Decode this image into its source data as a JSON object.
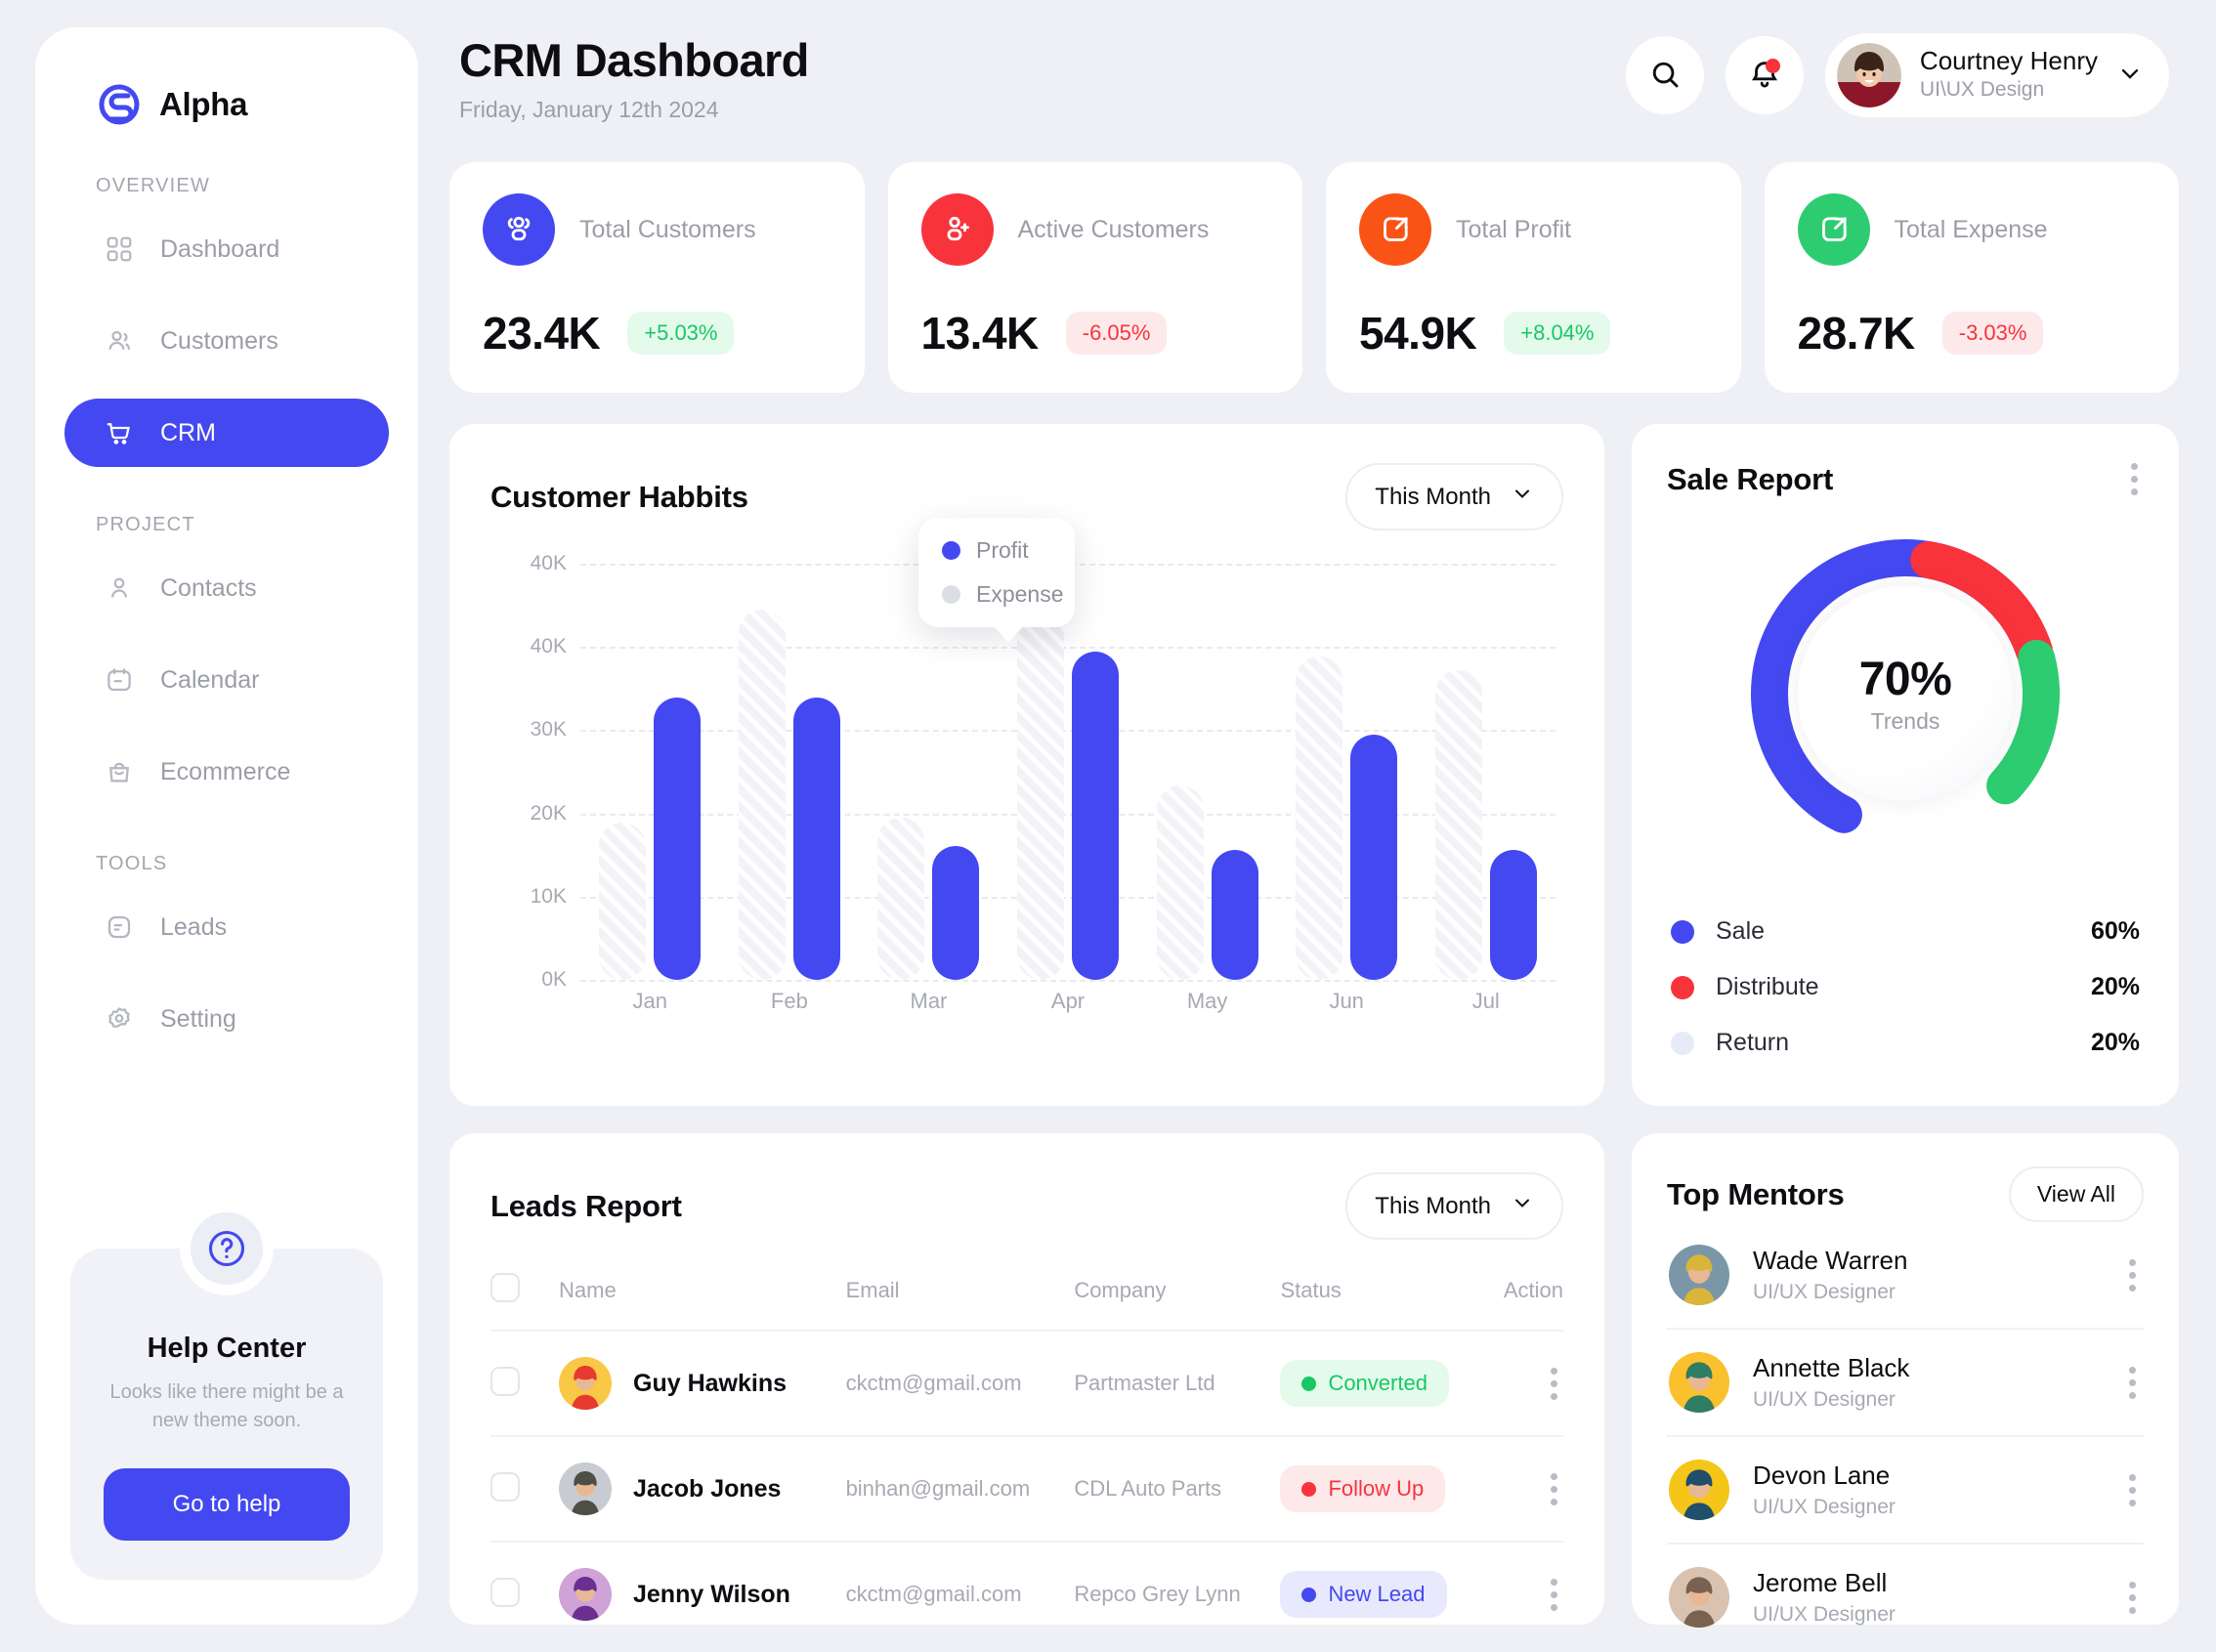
{
  "brand": {
    "name": "Alpha",
    "logo_icon": "alpha-s-logo"
  },
  "sidebar": {
    "sections": [
      {
        "label": "OVERVIEW",
        "items": [
          {
            "label": "Dashboard",
            "icon": "grid-icon",
            "active": false
          },
          {
            "label": "Customers",
            "icon": "users-icon",
            "active": false
          },
          {
            "label": "CRM",
            "icon": "cart-icon",
            "active": true
          }
        ]
      },
      {
        "label": "PROJECT",
        "items": [
          {
            "label": "Contacts",
            "icon": "user-icon",
            "active": false
          },
          {
            "label": "Calendar",
            "icon": "calendar-icon",
            "active": false
          },
          {
            "label": "Ecommerce",
            "icon": "bag-icon",
            "active": false
          }
        ]
      },
      {
        "label": "TOOLS",
        "items": [
          {
            "label": "Leads",
            "icon": "document-icon",
            "active": false
          },
          {
            "label": "Setting",
            "icon": "gear-icon",
            "active": false
          }
        ]
      }
    ],
    "help": {
      "icon": "question-mark-icon",
      "title": "Help Center",
      "subtitle": "Looks like there might be a new theme soon.",
      "button": "Go to help"
    }
  },
  "header": {
    "title": "CRM Dashboard",
    "date": "Friday, January 12th 2024",
    "search_icon": "search-icon",
    "bell_icon": "bell-icon",
    "user": {
      "name": "Courtney Henry",
      "role": "UI\\UX Design",
      "chevron": "chevron-down-icon"
    }
  },
  "stats": [
    {
      "label": "Total Customers",
      "value": "23.4K",
      "delta": "+5.03%",
      "dir": "up",
      "icon": "users-group-icon",
      "color": "#4448f0"
    },
    {
      "label": "Active Customers",
      "value": "13.4K",
      "delta": "-6.05%",
      "dir": "down",
      "icon": "user-plus-icon",
      "color": "#f8333c"
    },
    {
      "label": "Total Profit",
      "value": "54.9K",
      "delta": "+8.04%",
      "dir": "up",
      "icon": "arrow-in-box-icon",
      "color": "#fa5316"
    },
    {
      "label": "Total Expense",
      "value": "28.7K",
      "delta": "-3.03%",
      "dir": "down",
      "icon": "arrow-out-box-icon",
      "color": "#2ecc71"
    }
  ],
  "habits": {
    "title": "Customer Habbits",
    "filter": "This Month",
    "legend": [
      {
        "label": "Profit",
        "color": "#4448f0"
      },
      {
        "label": "Expense",
        "color": "#dcdee6"
      }
    ]
  },
  "chart_data": {
    "type": "bar",
    "title": "Customer Habbits",
    "xlabel": "",
    "ylabel": "",
    "categories": [
      "Jan",
      "Feb",
      "Mar",
      "Apr",
      "May",
      "Jun",
      "Jul"
    ],
    "ytick_labels": [
      "40K",
      "40K",
      "30K",
      "20K",
      "10K",
      "0K"
    ],
    "ylim": [
      0,
      45000
    ],
    "grid": true,
    "legend_position": "floating-top-center",
    "series": [
      {
        "name": "Expense",
        "color": "#dcdee6",
        "values": [
          17000,
          40000,
          17500,
          40000,
          21000,
          35000,
          33500
        ]
      },
      {
        "name": "Profit",
        "color": "#4448f0",
        "values": [
          30500,
          30500,
          14500,
          35500,
          14000,
          26500,
          14000
        ]
      }
    ]
  },
  "sale_report": {
    "title": "Sale Report",
    "kebab_icon": "more-vertical-icon",
    "center_value": "70%",
    "center_label": "Trends",
    "legend": [
      {
        "label": "Sale",
        "value": "60%",
        "color": "#4448f0"
      },
      {
        "label": "Distribute",
        "value": "20%",
        "color": "#f8333c"
      },
      {
        "label": "Return",
        "value": "20%",
        "color": "#e6ebf7"
      }
    ],
    "donut_segments": [
      {
        "name": "Sale",
        "percent": 60,
        "color": "#4448f0"
      },
      {
        "name": "Distribute",
        "percent": 20,
        "color": "#f8333c"
      },
      {
        "name": "Return",
        "percent": 20,
        "color": "#2ecc71"
      }
    ]
  },
  "leads": {
    "title": "Leads Report",
    "filter": "This Month",
    "columns": [
      "Name",
      "Email",
      "Company",
      "Status",
      "Action"
    ],
    "rows": [
      {
        "name": "Guy Hawkins",
        "email": "ckctm@gmail.com",
        "company": "Partmaster Ltd",
        "status": "Converted",
        "status_color": "#17c964",
        "status_bg": "#e4fbec",
        "avatar_a": "#f9c846",
        "avatar_b": "#e8392f"
      },
      {
        "name": "Jacob Jones",
        "email": "binhan@gmail.com",
        "company": "CDL Auto Parts",
        "status": "Follow Up",
        "status_color": "#f8333c",
        "status_bg": "#fde9ea",
        "avatar_a": "#c9cbd2",
        "avatar_b": "#4b4f45"
      },
      {
        "name": "Jenny Wilson",
        "email": "ckctm@gmail.com",
        "company": "Repco Grey Lynn",
        "status": "New Lead",
        "status_color": "#4448f0",
        "status_bg": "#e8e9fd",
        "avatar_a": "#cfa2d8",
        "avatar_b": "#6b2f8f"
      }
    ]
  },
  "mentors": {
    "title": "Top Mentors",
    "view_all": "View All",
    "items": [
      {
        "name": "Wade Warren",
        "role": "UI/UX Designer",
        "avatar_a": "#7a97a8",
        "avatar_b": "#d9b63a"
      },
      {
        "name": "Annette Black",
        "role": "UI/UX Designer",
        "avatar_a": "#fbc02d",
        "avatar_b": "#2f7d63"
      },
      {
        "name": "Devon Lane",
        "role": "UI/UX Designer",
        "avatar_a": "#f5c518",
        "avatar_b": "#1f4f6b"
      },
      {
        "name": "Jerome Bell",
        "role": "UI/UX Designer",
        "avatar_a": "#d9c3b0",
        "avatar_b": "#7b6250"
      }
    ]
  }
}
